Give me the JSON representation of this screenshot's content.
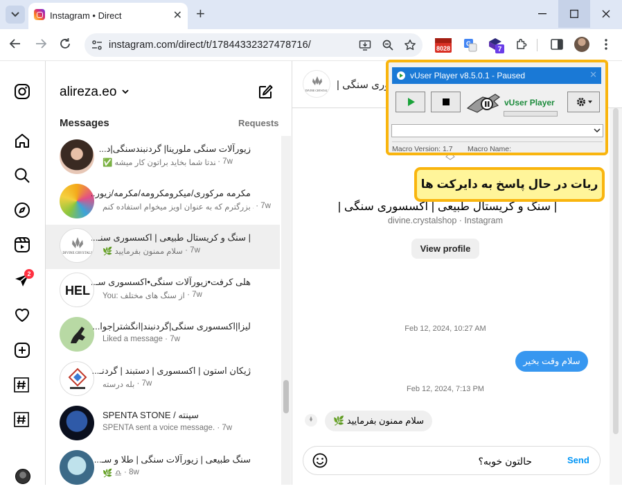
{
  "browser": {
    "tab_title": "Instagram • Direct",
    "url": "instagram.com/direct/t/17844332327478716/",
    "extensions": [
      {
        "name": "calendar-ext",
        "label": "8028",
        "color": "#d93025"
      },
      {
        "name": "translate-ext",
        "color": "#4285f4"
      },
      {
        "name": "shield-ext",
        "label": "7",
        "color": "#5b2fb0"
      },
      {
        "name": "puzzle-ext"
      }
    ]
  },
  "nav": {
    "messages_badge": "2"
  },
  "conversations": {
    "username": "alireza.eo",
    "messages_heading": "Messages",
    "requests_label": "Requests",
    "items": [
      {
        "name": "زیورآلات سنگی ملورینا| گردنبندسنگی|د...",
        "preview": "✅ هرچندتا شما بخاید براتون کار میشه",
        "time": "7w"
      },
      {
        "name": "مکرمه مرکوری/میکرومکرومه/مکرمه/زیور...",
        "preview": "سنگ بزرگترم که به عنوان اویز میخوام استفاده کنم",
        "time": "7w"
      },
      {
        "name": "| سنگ و کریستال طبیعی | اکسسوری سنـ...",
        "preview": "🌿 سلام ممنون بفرمایید",
        "time": "7w",
        "selected": true
      },
      {
        "name": "هلی کرفت•زیورآلات سنگی•اکسسوری سـ...",
        "preview": "You: از سنگ های مختلف",
        "time": "7w"
      },
      {
        "name": "لیزا|اکسسوری سنگی|گردنبند|انگشتر|جوا...",
        "preview": "Liked a message",
        "time": "7w"
      },
      {
        "name": "ژیکان استون | اکسسوری | دستبند | گردنـ...",
        "preview": "بله درسته",
        "time": "7w"
      },
      {
        "name": "SPENTA STONE / سپنته",
        "preview": "SPENTA sent a voice message.",
        "time": "7w"
      },
      {
        "name": "سنگ طبیعی | زیورآلات سنگی | طلا و سـ...",
        "preview": "🌿 ♎",
        "time": "8w"
      }
    ]
  },
  "chat": {
    "header_name": "| سنگ و کریستال طبیعی | اکسسوری سنگی",
    "header_name_short": "وری سنگی |",
    "profile_name": "| سنگ و کریستال طبیعی | اکسسوری سنگی |",
    "profile_sub": "divine.crystalshop · Instagram",
    "view_profile": "View profile",
    "timestamp_1": "Feb 12, 2024, 10:27 AM",
    "outgoing_msg": "سلام وقت بخیر",
    "timestamp_2": "Feb 12, 2024, 7:13 PM",
    "incoming_msg": "سلام ممنون بفرمایید 🌿",
    "input_value": "حالتون خوبه؟",
    "send_label": "Send"
  },
  "vuser": {
    "title": "vUser Player v8.5.0.1 - Paused",
    "brand": "vUser Player",
    "macro_version_label": "Macro Version: 1.7",
    "macro_name_label": "Macro Name:"
  },
  "callout_text": "ربات در حال پاسخ به دایرکت ها"
}
